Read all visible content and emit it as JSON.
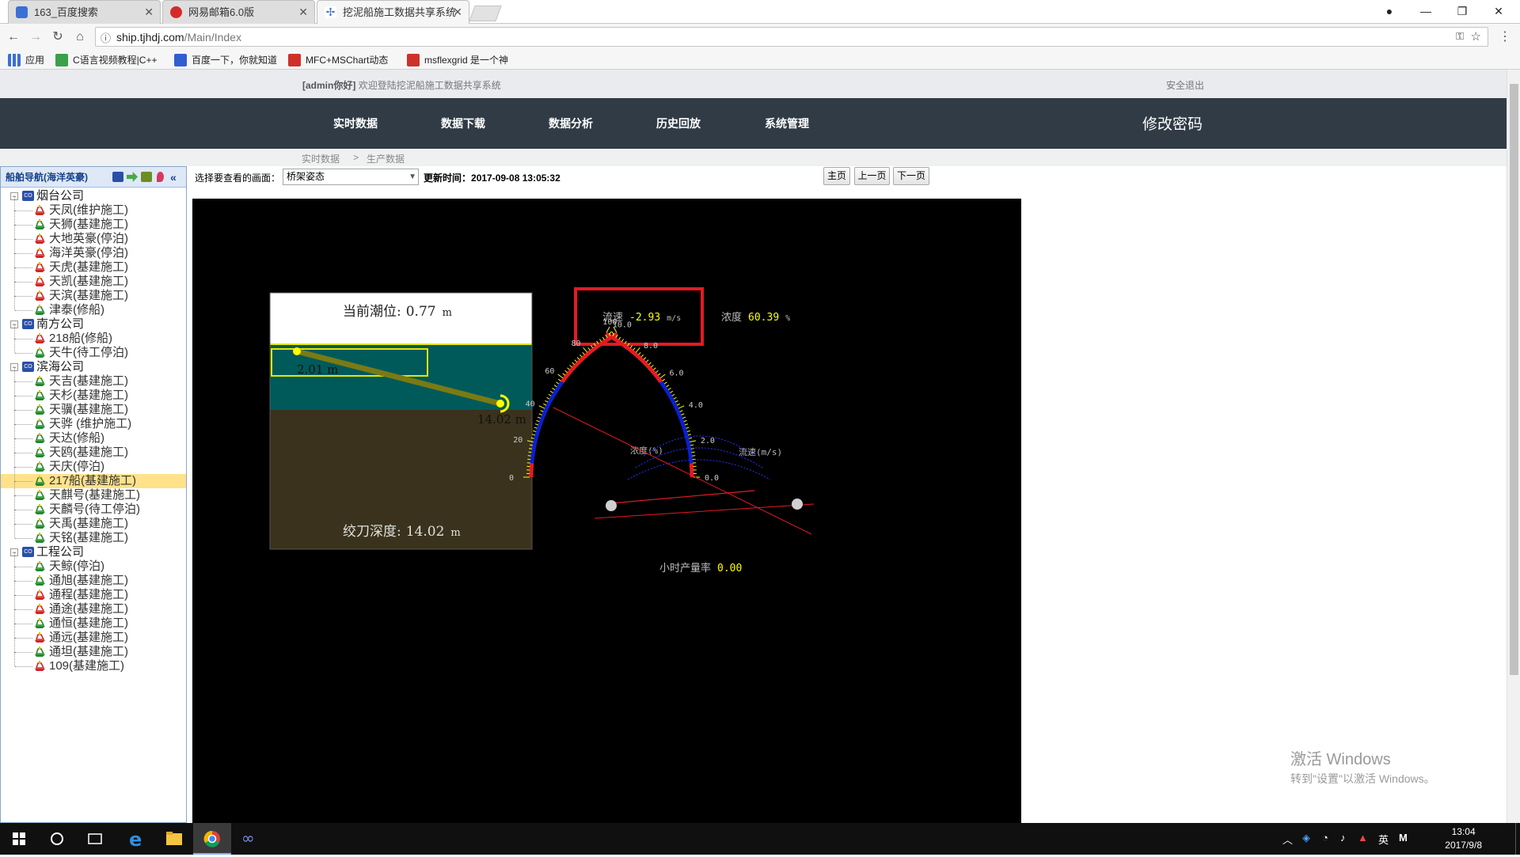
{
  "browser": {
    "tabs": [
      {
        "title": "163_百度搜索",
        "icon": "baidu-paw-icon",
        "color": "#3a6fd8"
      },
      {
        "title": "网易邮箱6.0版",
        "icon": "netease-mail-icon",
        "color": "#d42a2a"
      },
      {
        "title": "挖泥船施工数据共享系统",
        "icon": "compass-icon",
        "color": "#3a6fd8"
      }
    ],
    "url_host": "ship.tjhdj.com",
    "url_path": "/Main/Index",
    "bookmarks": [
      {
        "label": "应用",
        "icon": "apps-grid-icon",
        "color": "#3b6fd4"
      },
      {
        "label": "C语言视频教程|C++",
        "icon": "green-bookmark-icon",
        "color": "#3aa04a"
      },
      {
        "label": "百度一下，你就知道",
        "icon": "baidu-paw-icon",
        "color": "#2f5fd0"
      },
      {
        "label": "MFC+MSChart动态",
        "icon": "csdn-c-icon",
        "color": "#d0302a"
      },
      {
        "label": "msflexgrid 是一个神",
        "icon": "csdn-c-icon",
        "color": "#d0302a"
      }
    ]
  },
  "header": {
    "welcome_user": "[admin你好]",
    "welcome_text": "欢迎登陆挖泥船施工数据共享系统",
    "logout": "安全退出"
  },
  "nav": {
    "items": [
      "实时数据",
      "数据下载",
      "数据分析",
      "历史回放",
      "系统管理"
    ],
    "change_password": "修改密码"
  },
  "breadcrumb": {
    "root": "实时数据",
    "sep": ">",
    "current": "生产数据"
  },
  "sidebar": {
    "title": "船舶导航(海洋英豪)",
    "groups": [
      {
        "name": "烟台公司",
        "items": [
          {
            "label": "天凤(维护施工)",
            "status": "red"
          },
          {
            "label": "天狮(基建施工)",
            "status": "green"
          },
          {
            "label": "大地英豪(停泊)",
            "status": "red"
          },
          {
            "label": "海洋英豪(停泊)",
            "status": "red"
          },
          {
            "label": "天虎(基建施工)",
            "status": "red"
          },
          {
            "label": "天凯(基建施工)",
            "status": "red"
          },
          {
            "label": "天滨(基建施工)",
            "status": "red"
          },
          {
            "label": "津泰(修船)",
            "status": "green"
          }
        ]
      },
      {
        "name": "南方公司",
        "items": [
          {
            "label": "218船(修船)",
            "status": "red"
          },
          {
            "label": "天牛(待工停泊)",
            "status": "green"
          }
        ]
      },
      {
        "name": "滨海公司",
        "items": [
          {
            "label": "天吉(基建施工)",
            "status": "green"
          },
          {
            "label": "天杉(基建施工)",
            "status": "green"
          },
          {
            "label": "天骥(基建施工)",
            "status": "green"
          },
          {
            "label": "天骅 (维护施工)",
            "status": "green"
          },
          {
            "label": "天达(修船)",
            "status": "green"
          },
          {
            "label": "天鸥(基建施工)",
            "status": "green"
          },
          {
            "label": "天庆(停泊)",
            "status": "green"
          },
          {
            "label": "217船(基建施工)",
            "status": "green",
            "selected": true
          },
          {
            "label": "天麒号(基建施工)",
            "status": "green"
          },
          {
            "label": "天麟号(待工停泊)",
            "status": "green"
          },
          {
            "label": "天禹(基建施工)",
            "status": "green"
          },
          {
            "label": "天铭(基建施工)",
            "status": "green"
          }
        ]
      },
      {
        "name": "工程公司",
        "items": [
          {
            "label": "天鲸(停泊)",
            "status": "green"
          },
          {
            "label": "通旭(基建施工)",
            "status": "green"
          },
          {
            "label": "通程(基建施工)",
            "status": "red"
          },
          {
            "label": "通途(基建施工)",
            "status": "red"
          },
          {
            "label": "通恒(基建施工)",
            "status": "green"
          },
          {
            "label": "通远(基建施工)",
            "status": "red"
          },
          {
            "label": "通坦(基建施工)",
            "status": "green"
          },
          {
            "label": "109(基建施工)",
            "status": "red"
          }
        ]
      }
    ]
  },
  "toolbar": {
    "select_label": "选择要查看的画面：",
    "select_value": "桥架姿态",
    "update_label": "更新时间：",
    "update_time": "2017-09-08 13:05:32",
    "btn_home": "主页",
    "btn_prev": "上一页",
    "btn_next": "下一页"
  },
  "scene": {
    "tide_label": "当前潮位:",
    "tide_value": "0.77",
    "tide_unit": "m",
    "ladder_top_value": "2.01 m",
    "ladder_end_value": "14.02 m",
    "cutter_depth_label": "绞刀深度:",
    "cutter_depth_value": "14.02",
    "cutter_depth_unit": "m",
    "flow_label": "流速",
    "flow_value": "-2.93",
    "flow_unit": "m/s",
    "density_label": "浓度",
    "density_value": "60.39",
    "density_unit": "%",
    "left_gauge_name": "浓度(%)",
    "right_gauge_name": "流速(m/s)",
    "left_ticks": [
      "0",
      "20",
      "40",
      "60",
      "80",
      "100"
    ],
    "right_ticks": [
      "0.0",
      "2.0",
      "4.0",
      "6.0",
      "8.0",
      "10.0"
    ],
    "hourly_label": "小时产量率",
    "hourly_value": "0.00",
    "colors": {
      "water": "#005a5a",
      "seabed": "#3a321c",
      "ladder": "#7b7a14",
      "highlight": "#e31b23",
      "value": "#ffff00"
    }
  },
  "watermark": {
    "line1": "激活 Windows",
    "line2": "转到\"设置\"以激活 Windows。"
  },
  "taskbar": {
    "ime": "英",
    "time": "13:04",
    "date": "2017/9/8"
  }
}
